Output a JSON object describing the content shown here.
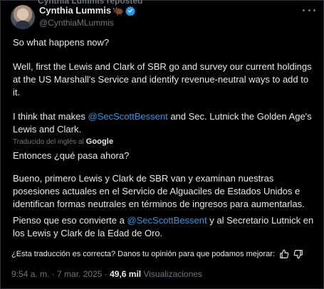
{
  "header": {
    "repost_text": "Cynthia Lummis reposted",
    "name": "Cynthia Lummis",
    "handle": "@CynthiaMLummis",
    "verified_color": "#1d9bf0",
    "badge_icon": "buffalo-emoji-icon"
  },
  "original": {
    "p1": "So what happens now?",
    "p2": "Well, first the Lewis and Clark of SBR go and survey our current holdings at the US Marshall's Service and identify revenue-neutral ways to add to it.",
    "p3_before": "I think that makes ",
    "p3_mention": "@SecScottBessent",
    "p3_after": " and Sec. Lutnick the Golden Age's Lewis and Clark."
  },
  "translation": {
    "translated_by": "Traducido del inglés al",
    "provider": "Google",
    "p1": "Entonces ¿qué pasa ahora?",
    "p2": "Bueno, primero Lewis y Clark de SBR van y examinan nuestras posesiones actuales en el Servicio de Alguaciles de Estados Unidos e identifican formas neutrales en términos de ingresos para aumentarlas.",
    "p3_before": "Pienso que eso convierte a ",
    "p3_mention": "@SecScottBessent",
    "p3_after": " y al Secretario Lutnick en los Lewis y Clark de la Edad de Oro."
  },
  "feedback": {
    "question": "¿Esta traducción es correcta? Danos tu opinión para que podamos mejorar:"
  },
  "meta": {
    "time": "9:54 a. m.",
    "sep1": " · ",
    "date": "7 mar. 2025",
    "sep2": " · ",
    "views": "49,6 mil",
    "views_label": " Visualizaciones"
  },
  "colors": {
    "background": "#000000",
    "text": "#e7e9ea",
    "muted": "#71767b",
    "link": "#1d9bf0"
  }
}
